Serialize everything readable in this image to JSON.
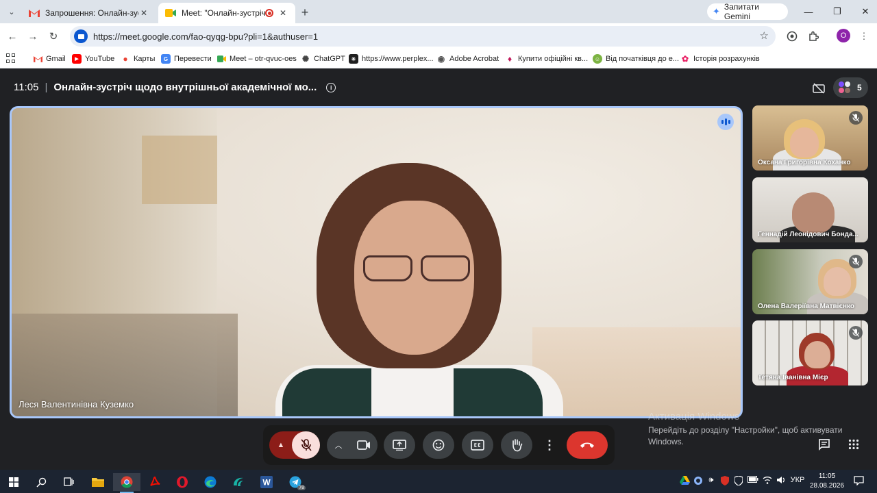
{
  "browser": {
    "tabs": [
      {
        "title": "Запрошення: Онлайн-зустріч щодо",
        "active": false
      },
      {
        "title": "Meet: \"Онлайн-зустріч щодо",
        "active": true
      }
    ],
    "gemini_label": "Запитати Gemini",
    "url": "https://meet.google.com/fao-qyqg-bpu?pli=1&authuser=1",
    "profile_initial": "O",
    "bookmarks": [
      {
        "label": "Gmail",
        "icon": "gmail-icon"
      },
      {
        "label": "YouTube",
        "icon": "youtube-icon"
      },
      {
        "label": "Карты",
        "icon": "maps-icon"
      },
      {
        "label": "Перевести",
        "icon": "translate-icon"
      },
      {
        "label": "Meet – otr-qvuc-oes",
        "icon": "meet-icon"
      },
      {
        "label": "ChatGPT",
        "icon": "chatgpt-icon"
      },
      {
        "label": "https://www.perplex...",
        "icon": "perplexity-icon"
      },
      {
        "label": "Adobe Acrobat",
        "icon": "acrobat-icon"
      },
      {
        "label": "Купити офіційні кв...",
        "icon": "ticket-icon"
      },
      {
        "label": "Від початківця до е...",
        "icon": "course-icon"
      },
      {
        "label": "Історія розрахунків",
        "icon": "history-icon"
      }
    ]
  },
  "meet": {
    "time": "11:05",
    "title": "Онлайн-зустріч щодо внутрішньої академічної мо...",
    "participants_count": "5",
    "main_speaker": "Леся Валентинівна Куземко",
    "tiles": [
      {
        "name": "Оксана Григорівна Коханко",
        "muted": true
      },
      {
        "name": "Геннадій Леонідович Бонда...",
        "muted": false
      },
      {
        "name": "Олена Валеріївна Матвієнко",
        "muted": true
      },
      {
        "name": "Тетяна Іванівна Мієр",
        "muted": true
      }
    ],
    "controls": [
      "mic-off",
      "camera",
      "present",
      "reactions",
      "captions",
      "raise-hand",
      "more",
      "end-call"
    ]
  },
  "windows": {
    "activate_title": "Активація Windows",
    "activate_text": "Перейдіть до розділу \"Настройки\", щоб активувати Windows.",
    "language": "УКР",
    "clock_time": "11:05",
    "clock_date": "28.08.2026",
    "telegram_badge": "78"
  },
  "colors": {
    "meet_bg": "#202124",
    "active_border": "#a8c7fa",
    "end_call": "#dc362e",
    "mic_off_bg": "#8c1d18",
    "taskbar": "#1c2431"
  }
}
